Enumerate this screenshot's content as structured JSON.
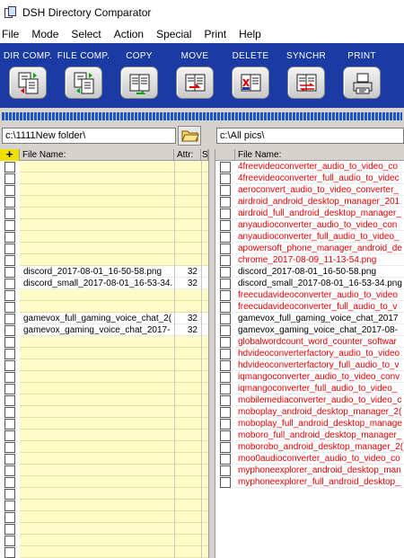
{
  "app": {
    "title": "DSH Directory Comparator"
  },
  "menu": [
    "File",
    "Mode",
    "Select",
    "Action",
    "Special",
    "Print",
    "Help"
  ],
  "toolbar": [
    {
      "label": "DIR COMP.",
      "icon": "dir-compare-icon"
    },
    {
      "label": "FILE COMP.",
      "icon": "file-compare-icon"
    },
    {
      "label": "COPY",
      "icon": "copy-icon"
    },
    {
      "label": "MOVE",
      "icon": "move-icon"
    },
    {
      "label": "DELETE",
      "icon": "delete-icon"
    },
    {
      "label": "SYNCHR",
      "icon": "synchronize-icon"
    },
    {
      "label": "PRINT",
      "icon": "print-icon"
    }
  ],
  "left": {
    "path": "c:\\1111New folder\\",
    "headers": {
      "name": "File Name:",
      "attr": "Attr:",
      "size": "S"
    },
    "rows": [
      {
        "name": "",
        "attr": ""
      },
      {
        "name": "",
        "attr": ""
      },
      {
        "name": "",
        "attr": ""
      },
      {
        "name": "",
        "attr": ""
      },
      {
        "name": "",
        "attr": ""
      },
      {
        "name": "",
        "attr": ""
      },
      {
        "name": "",
        "attr": ""
      },
      {
        "name": "",
        "attr": ""
      },
      {
        "name": "",
        "attr": ""
      },
      {
        "name": "discord_2017-08-01_16-50-58.png",
        "attr": "32"
      },
      {
        "name": "discord_small_2017-08-01_16-53-34.",
        "attr": "32"
      },
      {
        "name": "",
        "attr": ""
      },
      {
        "name": "",
        "attr": ""
      },
      {
        "name": "gamevox_full_gaming_voice_chat_2(",
        "attr": "32"
      },
      {
        "name": "gamevox_gaming_voice_chat_2017-",
        "attr": "32"
      },
      {
        "name": "",
        "attr": ""
      },
      {
        "name": "",
        "attr": ""
      },
      {
        "name": "",
        "attr": ""
      },
      {
        "name": "",
        "attr": ""
      },
      {
        "name": "",
        "attr": ""
      },
      {
        "name": "",
        "attr": ""
      },
      {
        "name": "",
        "attr": ""
      },
      {
        "name": "",
        "attr": ""
      },
      {
        "name": "",
        "attr": ""
      },
      {
        "name": "",
        "attr": ""
      },
      {
        "name": "",
        "attr": ""
      },
      {
        "name": "",
        "attr": ""
      },
      {
        "name": "",
        "attr": ""
      },
      {
        "name": "",
        "attr": ""
      },
      {
        "name": "",
        "attr": ""
      },
      {
        "name": "",
        "attr": ""
      },
      {
        "name": "",
        "attr": ""
      },
      {
        "name": "",
        "attr": ""
      },
      {
        "name": "",
        "attr": ""
      }
    ]
  },
  "right": {
    "path": "c:\\All pics\\",
    "headers": {
      "name": "File Name:"
    },
    "rows": [
      {
        "name": "4freevideoconverter_audio_to_video_co",
        "color": "red"
      },
      {
        "name": "4freevideoconverter_full_audio_to_videc",
        "color": "red"
      },
      {
        "name": "aeroconvert_audio_to_video_converter_",
        "color": "red"
      },
      {
        "name": "airdroid_android_desktop_manager_201",
        "color": "red"
      },
      {
        "name": "airdroid_full_android_desktop_manager_",
        "color": "red"
      },
      {
        "name": "anyaudioconverter_audio_to_video_con",
        "color": "red"
      },
      {
        "name": "anyaudioconverter_full_audio_to_video_",
        "color": "red"
      },
      {
        "name": "apowersoft_phone_manager_android_de",
        "color": "red"
      },
      {
        "name": "chrome_2017-08-09_11-13-54.png",
        "color": "red"
      },
      {
        "name": "discord_2017-08-01_16-50-58.png",
        "color": "black"
      },
      {
        "name": "discord_small_2017-08-01_16-53-34.png",
        "color": "black"
      },
      {
        "name": "freecudavideoconverter_audio_to_video",
        "color": "red"
      },
      {
        "name": "freecudavideoconverter_full_audio_to_v",
        "color": "red"
      },
      {
        "name": "gamevox_full_gaming_voice_chat_2017",
        "color": "black"
      },
      {
        "name": "gamevox_gaming_voice_chat_2017-08-",
        "color": "black"
      },
      {
        "name": "globalwordcount_word_counter_softwar",
        "color": "red"
      },
      {
        "name": "hdvideoconverterfactory_audio_to_video",
        "color": "red"
      },
      {
        "name": "hdvideoconverterfactory_full_audio_to_v",
        "color": "red"
      },
      {
        "name": "iqmangoconverter_audio_to_video_conv",
        "color": "red"
      },
      {
        "name": "iqmangoconverter_full_audio_to_video_",
        "color": "red"
      },
      {
        "name": "mobilemediaconverter_audio_to_video_c",
        "color": "red"
      },
      {
        "name": "moboplay_android_desktop_manager_2(",
        "color": "red"
      },
      {
        "name": "moboplay_full_android_desktop_manage",
        "color": "red"
      },
      {
        "name": "moboro_full_android_desktop_manager_",
        "color": "red"
      },
      {
        "name": "moborobo_android_desktop_manager_2(",
        "color": "red"
      },
      {
        "name": "moo0audioconverter_audio_to_video_co",
        "color": "red"
      },
      {
        "name": "myphoneexplorer_android_desktop_man",
        "color": "red"
      },
      {
        "name": "myphoneexplorer_full_android_desktop_",
        "color": "red"
      }
    ]
  }
}
